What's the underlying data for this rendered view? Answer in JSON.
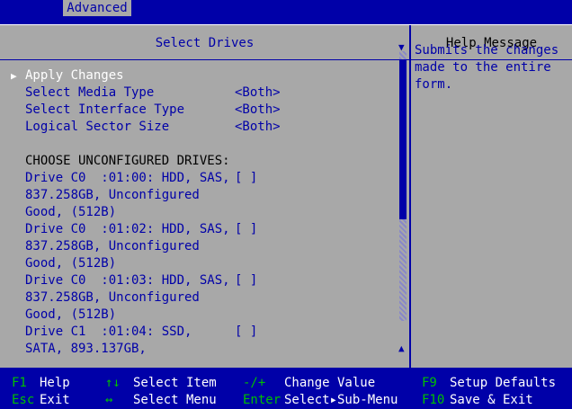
{
  "tab": "Advanced",
  "left_title": "Select Drives",
  "right_title": "Help Message",
  "menu": [
    {
      "label": "Apply Changes",
      "value": ""
    },
    {
      "label": "Select Media Type",
      "value": "<Both>"
    },
    {
      "label": "Select Interface Type",
      "value": "<Both>"
    },
    {
      "label": "Logical Sector Size",
      "value": "<Both>"
    },
    {
      "label": "CHOOSE UNCONFIGURED DRIVES:",
      "value": ""
    }
  ],
  "drives": [
    {
      "line1": "Drive C0  :01:00: HDD, SAS,",
      "line2": "837.258GB, Unconfigured",
      "line3": "Good, (512B)",
      "check": "[ ]"
    },
    {
      "line1": "Drive C0  :01:02: HDD, SAS,",
      "line2": "837.258GB, Unconfigured",
      "line3": "Good, (512B)",
      "check": "[ ]"
    },
    {
      "line1": "Drive C0  :01:03: HDD, SAS,",
      "line2": "837.258GB, Unconfigured",
      "line3": "Good, (512B)",
      "check": "[ ]"
    },
    {
      "line1": "Drive C1  :01:04: SSD,",
      "line2": "SATA, 893.137GB,",
      "line3": "",
      "check": "[ ]"
    }
  ],
  "help_text": "Submits the changes made to the entire form.",
  "footer": {
    "f1_key": "F1",
    "f1_text": "Help",
    "arrows_key": "↑↓",
    "arrows_text": "Select Item",
    "pm_key": "-/+",
    "pm_text": "Change Value",
    "f9_key": "F9",
    "f9_text": "Setup Defaults",
    "esc_key": "Esc",
    "esc_text": "Exit",
    "lr_key": "↔",
    "lr_text": "Select Menu",
    "enter_key": "Enter",
    "enter_text": "Select▸Sub-Menu",
    "f10_key": "F10",
    "f10_text": "Save & Exit"
  },
  "colors": {
    "bios_blue": "#0000a8",
    "panel_gray": "#a8a8a8",
    "key_green": "#00c000"
  }
}
